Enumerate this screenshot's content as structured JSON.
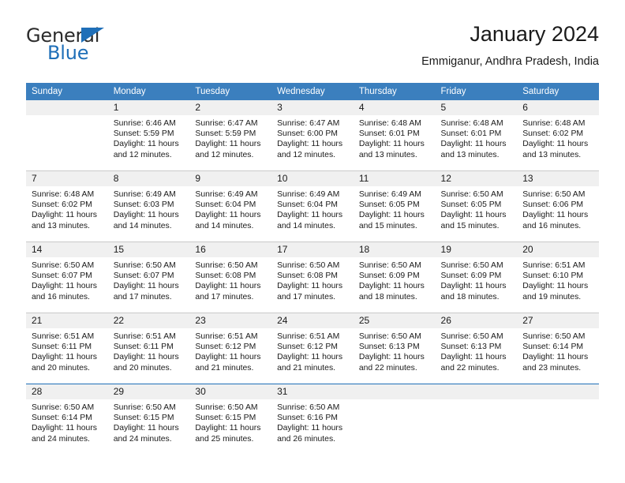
{
  "brand": {
    "name_part1": "General",
    "name_part2": "Blue",
    "accent_color": "#1f6fb8"
  },
  "header": {
    "title": "January 2024",
    "subtitle": "Emmiganur, Andhra Pradesh, India"
  },
  "theme": {
    "header_bar_color": "#3b7fbe",
    "daynum_band_color": "#f0f0f0",
    "grid_line_color": "#c9c9c9"
  },
  "weekday_headers": [
    "Sunday",
    "Monday",
    "Tuesday",
    "Wednesday",
    "Thursday",
    "Friday",
    "Saturday"
  ],
  "weeks": [
    [
      {
        "day": "",
        "sunrise": "",
        "sunset": "",
        "daylight_line1": "",
        "daylight_line2": ""
      },
      {
        "day": "1",
        "sunrise": "Sunrise: 6:46 AM",
        "sunset": "Sunset: 5:59 PM",
        "daylight_line1": "Daylight: 11 hours",
        "daylight_line2": "and 12 minutes."
      },
      {
        "day": "2",
        "sunrise": "Sunrise: 6:47 AM",
        "sunset": "Sunset: 5:59 PM",
        "daylight_line1": "Daylight: 11 hours",
        "daylight_line2": "and 12 minutes."
      },
      {
        "day": "3",
        "sunrise": "Sunrise: 6:47 AM",
        "sunset": "Sunset: 6:00 PM",
        "daylight_line1": "Daylight: 11 hours",
        "daylight_line2": "and 12 minutes."
      },
      {
        "day": "4",
        "sunrise": "Sunrise: 6:48 AM",
        "sunset": "Sunset: 6:01 PM",
        "daylight_line1": "Daylight: 11 hours",
        "daylight_line2": "and 13 minutes."
      },
      {
        "day": "5",
        "sunrise": "Sunrise: 6:48 AM",
        "sunset": "Sunset: 6:01 PM",
        "daylight_line1": "Daylight: 11 hours",
        "daylight_line2": "and 13 minutes."
      },
      {
        "day": "6",
        "sunrise": "Sunrise: 6:48 AM",
        "sunset": "Sunset: 6:02 PM",
        "daylight_line1": "Daylight: 11 hours",
        "daylight_line2": "and 13 minutes."
      }
    ],
    [
      {
        "day": "7",
        "sunrise": "Sunrise: 6:48 AM",
        "sunset": "Sunset: 6:02 PM",
        "daylight_line1": "Daylight: 11 hours",
        "daylight_line2": "and 13 minutes."
      },
      {
        "day": "8",
        "sunrise": "Sunrise: 6:49 AM",
        "sunset": "Sunset: 6:03 PM",
        "daylight_line1": "Daylight: 11 hours",
        "daylight_line2": "and 14 minutes."
      },
      {
        "day": "9",
        "sunrise": "Sunrise: 6:49 AM",
        "sunset": "Sunset: 6:04 PM",
        "daylight_line1": "Daylight: 11 hours",
        "daylight_line2": "and 14 minutes."
      },
      {
        "day": "10",
        "sunrise": "Sunrise: 6:49 AM",
        "sunset": "Sunset: 6:04 PM",
        "daylight_line1": "Daylight: 11 hours",
        "daylight_line2": "and 14 minutes."
      },
      {
        "day": "11",
        "sunrise": "Sunrise: 6:49 AM",
        "sunset": "Sunset: 6:05 PM",
        "daylight_line1": "Daylight: 11 hours",
        "daylight_line2": "and 15 minutes."
      },
      {
        "day": "12",
        "sunrise": "Sunrise: 6:50 AM",
        "sunset": "Sunset: 6:05 PM",
        "daylight_line1": "Daylight: 11 hours",
        "daylight_line2": "and 15 minutes."
      },
      {
        "day": "13",
        "sunrise": "Sunrise: 6:50 AM",
        "sunset": "Sunset: 6:06 PM",
        "daylight_line1": "Daylight: 11 hours",
        "daylight_line2": "and 16 minutes."
      }
    ],
    [
      {
        "day": "14",
        "sunrise": "Sunrise: 6:50 AM",
        "sunset": "Sunset: 6:07 PM",
        "daylight_line1": "Daylight: 11 hours",
        "daylight_line2": "and 16 minutes."
      },
      {
        "day": "15",
        "sunrise": "Sunrise: 6:50 AM",
        "sunset": "Sunset: 6:07 PM",
        "daylight_line1": "Daylight: 11 hours",
        "daylight_line2": "and 17 minutes."
      },
      {
        "day": "16",
        "sunrise": "Sunrise: 6:50 AM",
        "sunset": "Sunset: 6:08 PM",
        "daylight_line1": "Daylight: 11 hours",
        "daylight_line2": "and 17 minutes."
      },
      {
        "day": "17",
        "sunrise": "Sunrise: 6:50 AM",
        "sunset": "Sunset: 6:08 PM",
        "daylight_line1": "Daylight: 11 hours",
        "daylight_line2": "and 17 minutes."
      },
      {
        "day": "18",
        "sunrise": "Sunrise: 6:50 AM",
        "sunset": "Sunset: 6:09 PM",
        "daylight_line1": "Daylight: 11 hours",
        "daylight_line2": "and 18 minutes."
      },
      {
        "day": "19",
        "sunrise": "Sunrise: 6:50 AM",
        "sunset": "Sunset: 6:09 PM",
        "daylight_line1": "Daylight: 11 hours",
        "daylight_line2": "and 18 minutes."
      },
      {
        "day": "20",
        "sunrise": "Sunrise: 6:51 AM",
        "sunset": "Sunset: 6:10 PM",
        "daylight_line1": "Daylight: 11 hours",
        "daylight_line2": "and 19 minutes."
      }
    ],
    [
      {
        "day": "21",
        "sunrise": "Sunrise: 6:51 AM",
        "sunset": "Sunset: 6:11 PM",
        "daylight_line1": "Daylight: 11 hours",
        "daylight_line2": "and 20 minutes."
      },
      {
        "day": "22",
        "sunrise": "Sunrise: 6:51 AM",
        "sunset": "Sunset: 6:11 PM",
        "daylight_line1": "Daylight: 11 hours",
        "daylight_line2": "and 20 minutes."
      },
      {
        "day": "23",
        "sunrise": "Sunrise: 6:51 AM",
        "sunset": "Sunset: 6:12 PM",
        "daylight_line1": "Daylight: 11 hours",
        "daylight_line2": "and 21 minutes."
      },
      {
        "day": "24",
        "sunrise": "Sunrise: 6:51 AM",
        "sunset": "Sunset: 6:12 PM",
        "daylight_line1": "Daylight: 11 hours",
        "daylight_line2": "and 21 minutes."
      },
      {
        "day": "25",
        "sunrise": "Sunrise: 6:50 AM",
        "sunset": "Sunset: 6:13 PM",
        "daylight_line1": "Daylight: 11 hours",
        "daylight_line2": "and 22 minutes."
      },
      {
        "day": "26",
        "sunrise": "Sunrise: 6:50 AM",
        "sunset": "Sunset: 6:13 PM",
        "daylight_line1": "Daylight: 11 hours",
        "daylight_line2": "and 22 minutes."
      },
      {
        "day": "27",
        "sunrise": "Sunrise: 6:50 AM",
        "sunset": "Sunset: 6:14 PM",
        "daylight_line1": "Daylight: 11 hours",
        "daylight_line2": "and 23 minutes."
      }
    ],
    [
      {
        "day": "28",
        "sunrise": "Sunrise: 6:50 AM",
        "sunset": "Sunset: 6:14 PM",
        "daylight_line1": "Daylight: 11 hours",
        "daylight_line2": "and 24 minutes."
      },
      {
        "day": "29",
        "sunrise": "Sunrise: 6:50 AM",
        "sunset": "Sunset: 6:15 PM",
        "daylight_line1": "Daylight: 11 hours",
        "daylight_line2": "and 24 minutes."
      },
      {
        "day": "30",
        "sunrise": "Sunrise: 6:50 AM",
        "sunset": "Sunset: 6:15 PM",
        "daylight_line1": "Daylight: 11 hours",
        "daylight_line2": "and 25 minutes."
      },
      {
        "day": "31",
        "sunrise": "Sunrise: 6:50 AM",
        "sunset": "Sunset: 6:16 PM",
        "daylight_line1": "Daylight: 11 hours",
        "daylight_line2": "and 26 minutes."
      },
      {
        "day": "",
        "sunrise": "",
        "sunset": "",
        "daylight_line1": "",
        "daylight_line2": ""
      },
      {
        "day": "",
        "sunrise": "",
        "sunset": "",
        "daylight_line1": "",
        "daylight_line2": ""
      },
      {
        "day": "",
        "sunrise": "",
        "sunset": "",
        "daylight_line1": "",
        "daylight_line2": ""
      }
    ]
  ]
}
